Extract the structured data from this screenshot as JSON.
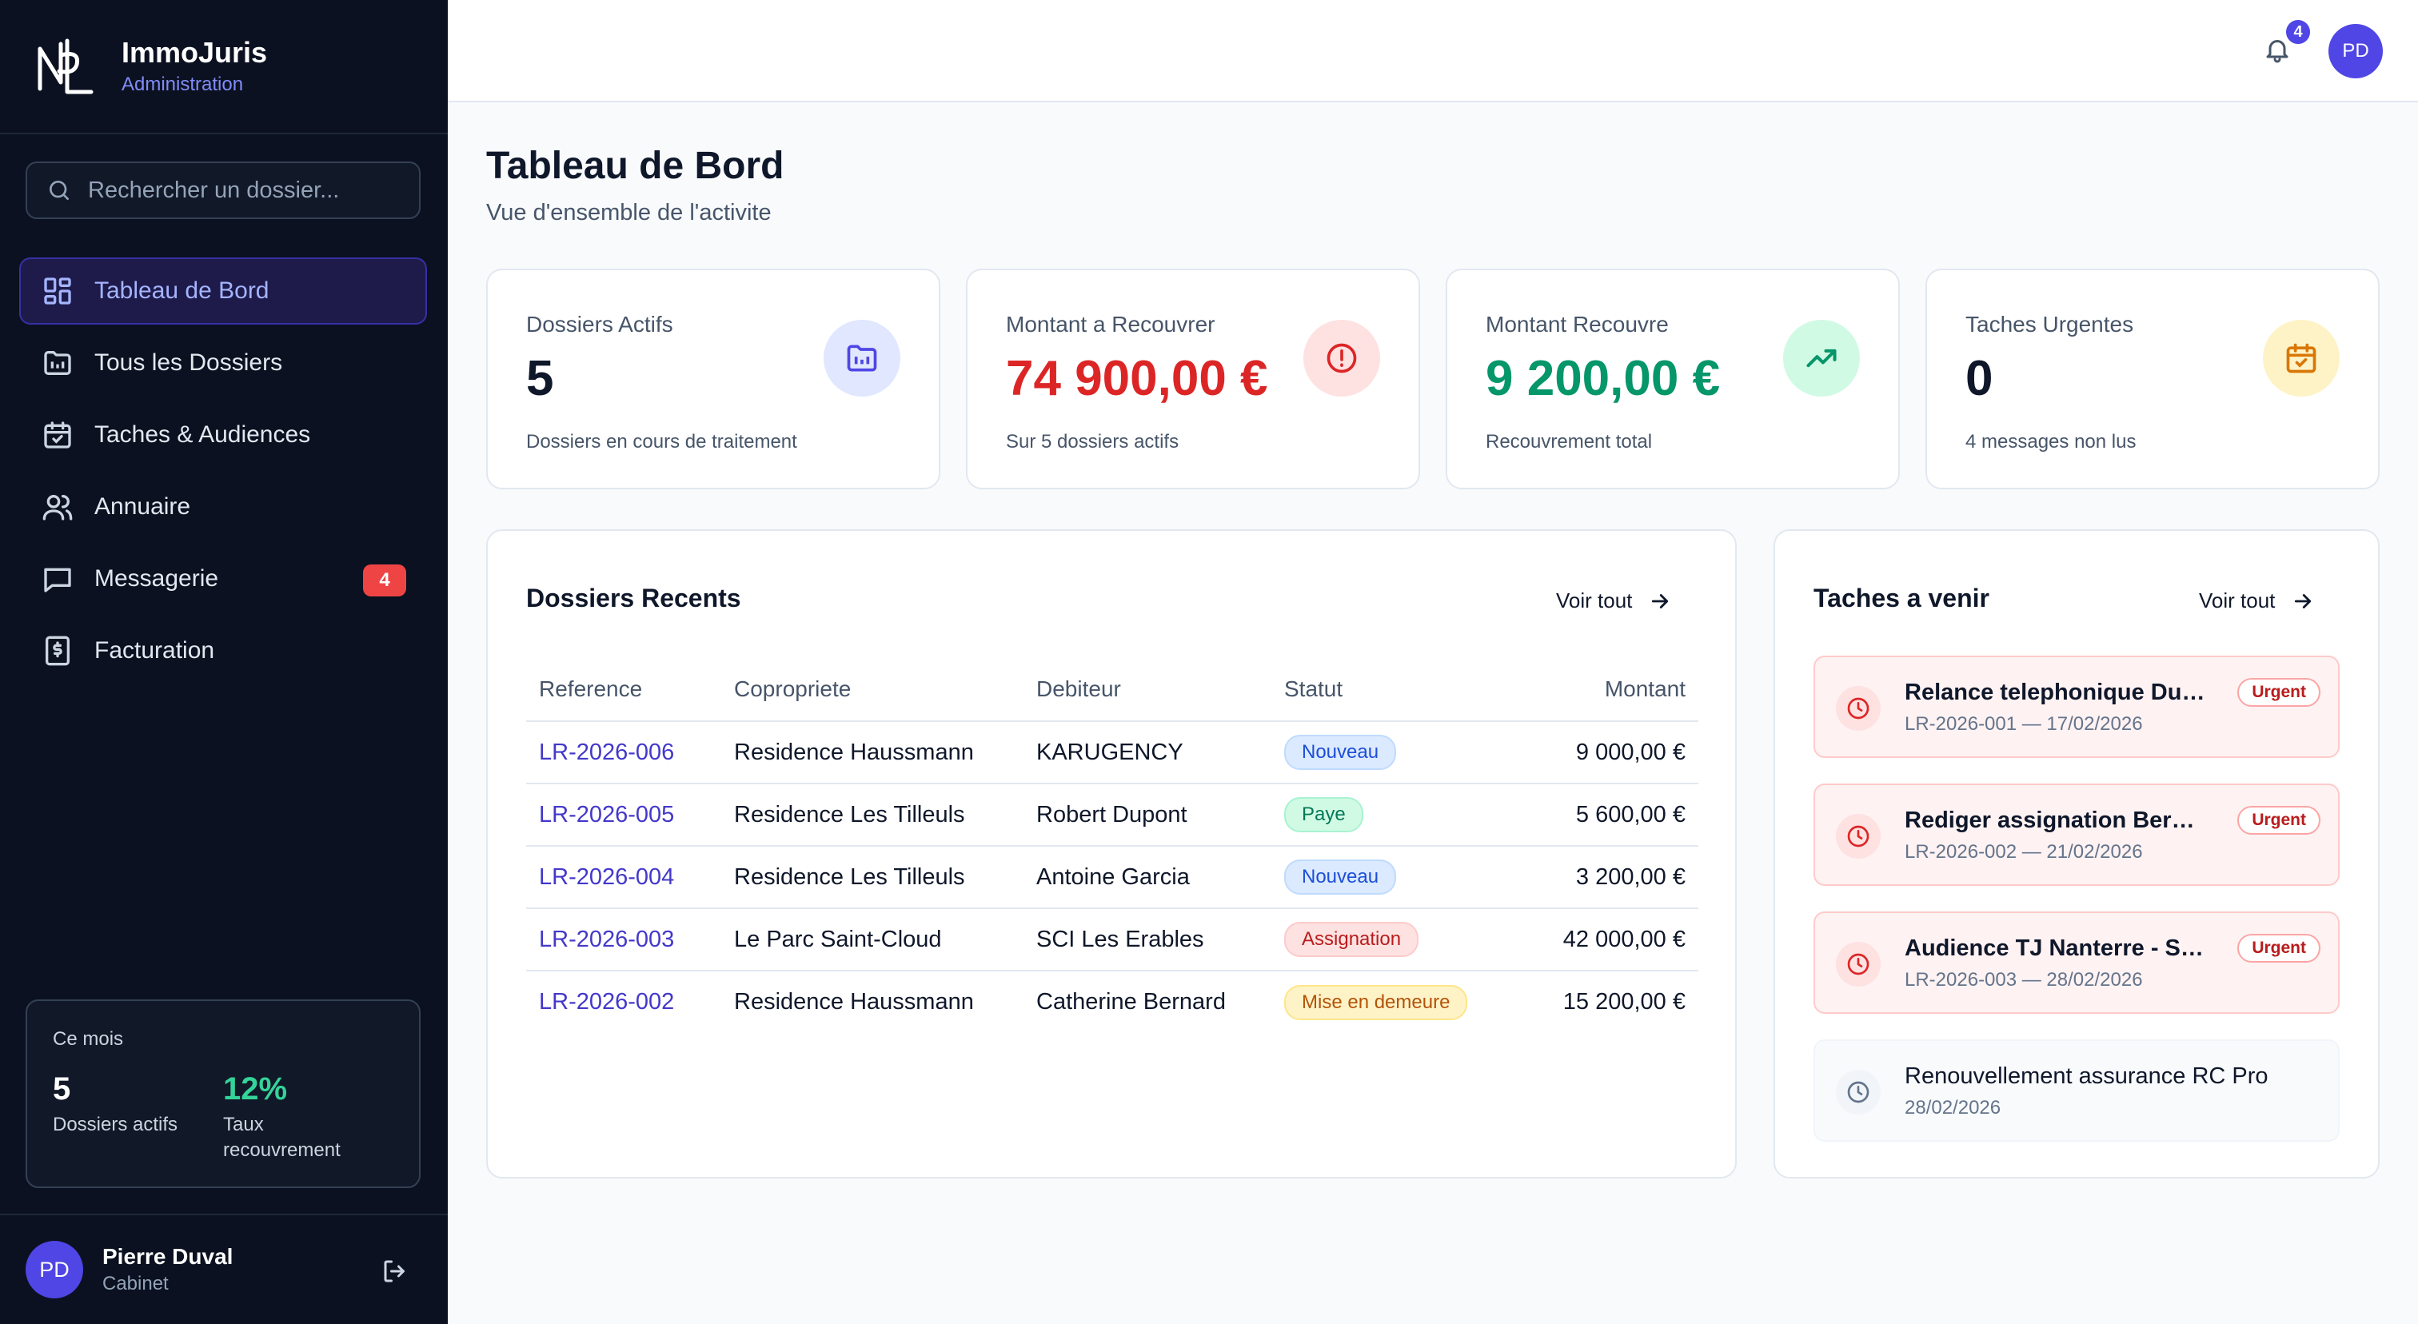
{
  "brand": {
    "name": "ImmoJuris",
    "subtitle": "Administration"
  },
  "search": {
    "placeholder": "Rechercher un dossier..."
  },
  "nav": {
    "items": [
      {
        "label": "Tableau de Bord",
        "icon": "dashboard-icon"
      },
      {
        "label": "Tous les Dossiers",
        "icon": "folder-icon"
      },
      {
        "label": "Taches & Audiences",
        "icon": "calendar-icon"
      },
      {
        "label": "Annuaire",
        "icon": "users-icon"
      },
      {
        "label": "Messagerie",
        "icon": "message-icon",
        "badge": "4"
      },
      {
        "label": "Facturation",
        "icon": "invoice-icon"
      }
    ]
  },
  "month": {
    "label": "Ce mois",
    "stat1": {
      "value": "5",
      "label": "Dossiers actifs"
    },
    "stat2": {
      "value": "12%",
      "label": "Taux recouvrement"
    }
  },
  "user": {
    "initials": "PD",
    "name": "Pierre Duval",
    "role": "Cabinet"
  },
  "header": {
    "notifications": "4",
    "initials": "PD"
  },
  "page": {
    "title": "Tableau de Bord",
    "subtitle": "Vue d'ensemble de l'activite"
  },
  "stats": [
    {
      "label": "Dossiers Actifs",
      "value": "5",
      "desc": "Dossiers en cours de traitement",
      "color": "#4f46e5"
    },
    {
      "label": "Montant a Recouvrer",
      "value": "74 900,00 €",
      "desc": "Sur 5 dossiers actifs",
      "color": "#dc2626"
    },
    {
      "label": "Montant Recouvre",
      "value": "9 200,00 €",
      "desc": "Recouvrement total",
      "color": "#059669"
    },
    {
      "label": "Taches Urgentes",
      "value": "0",
      "desc": "4 messages non lus",
      "color": "#d97706"
    }
  ],
  "recent": {
    "title": "Dossiers Recents",
    "see_all": "Voir tout",
    "columns": [
      "Reference",
      "Copropriete",
      "Debiteur",
      "Statut",
      "Montant"
    ],
    "rows": [
      {
        "ref": "LR-2026-006",
        "copro": "Residence Haussmann",
        "debiteur": "KARUGENCY",
        "statut": "Nouveau",
        "montant": "9 000,00 €"
      },
      {
        "ref": "LR-2026-005",
        "copro": "Residence Les Tilleuls",
        "debiteur": "Robert Dupont",
        "statut": "Paye",
        "montant": "5 600,00 €"
      },
      {
        "ref": "LR-2026-004",
        "copro": "Residence Les Tilleuls",
        "debiteur": "Antoine Garcia",
        "statut": "Nouveau",
        "montant": "3 200,00 €"
      },
      {
        "ref": "LR-2026-003",
        "copro": "Le Parc Saint-Cloud",
        "debiteur": "SCI Les Erables",
        "statut": "Assignation",
        "montant": "42 000,00 €"
      },
      {
        "ref": "LR-2026-002",
        "copro": "Residence Haussmann",
        "debiteur": "Catherine Bernard",
        "statut": "Mise en demeure",
        "montant": "15 200,00 €"
      }
    ]
  },
  "tasks": {
    "title": "Taches a venir",
    "see_all": "Voir tout",
    "items": [
      {
        "title": "Relance telephonique Dup...",
        "meta": "LR-2026-001 — 17/02/2026",
        "badge": "Urgent"
      },
      {
        "title": "Rediger assignation Bernard",
        "meta": "LR-2026-002 — 21/02/2026",
        "badge": "Urgent"
      },
      {
        "title": "Audience TJ Nanterre - SCI...",
        "meta": "LR-2026-003 — 28/02/2026",
        "badge": "Urgent"
      },
      {
        "title": "Renouvellement assurance RC Pro",
        "meta": "28/02/2026"
      }
    ]
  },
  "status_colors": {
    "Nouveau": {
      "bg": "#dbeafe",
      "border": "#bfdbfe",
      "text": "#1d4ed8"
    },
    "Paye": {
      "bg": "#d1fae5",
      "border": "#a7f3d0",
      "text": "#047857"
    },
    "Assignation": {
      "bg": "#fee2e2",
      "border": "#fecaca",
      "text": "#b91c1c"
    },
    "Mise en demeure": {
      "bg": "#fef3c7",
      "border": "#fde68a",
      "text": "#b45309"
    }
  }
}
